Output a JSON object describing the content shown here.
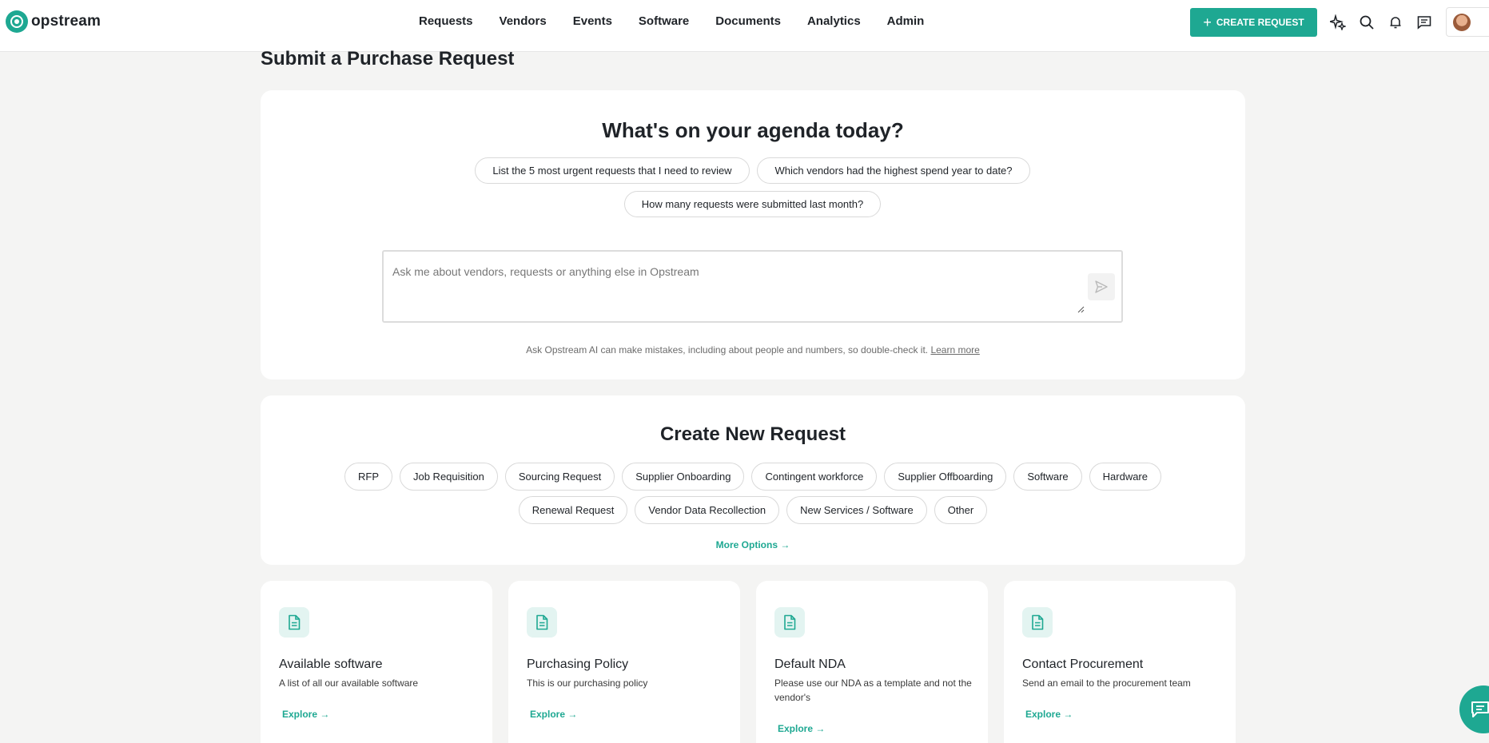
{
  "header": {
    "logo_text": "opstream",
    "nav": [
      "Requests",
      "Vendors",
      "Events",
      "Software",
      "Documents",
      "Analytics",
      "Admin"
    ],
    "create_button": "CREATE REQUEST",
    "icons": [
      "sparkle-icon",
      "search-icon",
      "bell-icon",
      "messages-icon"
    ]
  },
  "page": {
    "title": "Submit a Purchase Request"
  },
  "agenda": {
    "title": "What's on your agenda today?",
    "suggestions": [
      "List the 5 most urgent requests that I need to review",
      "Which vendors had the highest spend year to date?",
      "How many requests were submitted last month?"
    ],
    "input_placeholder": "Ask me about vendors, requests or anything else in Opstream",
    "disclaimer": "Ask Opstream AI can make mistakes, including about people and numbers, so double-check it.",
    "learn_more": "Learn more"
  },
  "create_request": {
    "title": "Create New Request",
    "types_row1": [
      "RFP",
      "Job Requisition",
      "Sourcing Request",
      "Supplier Onboarding",
      "Contingent workforce",
      "Supplier Offboarding",
      "Software",
      "Hardware"
    ],
    "types_row2": [
      "Renewal Request",
      "Vendor Data Recollection",
      "New Services / Software",
      "Other"
    ],
    "more_options": "More Options →"
  },
  "resources": [
    {
      "title": "Available software",
      "description": "A list of all our available software",
      "link": "Explore →"
    },
    {
      "title": "Purchasing Policy",
      "description": "This is our purchasing policy",
      "link": "Explore →"
    },
    {
      "title": "Default NDA",
      "description": "Please use our NDA as a template and not the vendor's",
      "link": "Explore →"
    },
    {
      "title": "Contact Procurement",
      "description": "Send an email to the procurement team",
      "link": "Explore →"
    }
  ],
  "colors": {
    "accent": "#1ea892",
    "background": "#f4f4f3",
    "card": "#ffffff"
  }
}
